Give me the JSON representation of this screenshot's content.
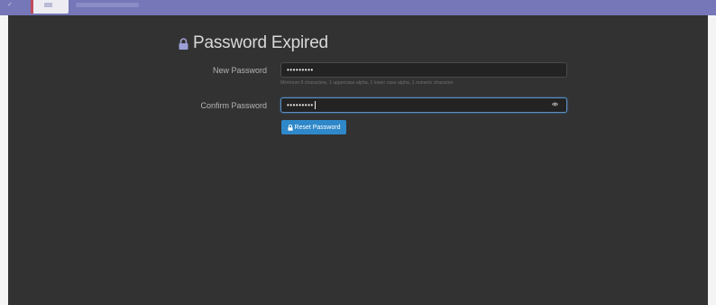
{
  "page": {
    "title": "Password Expired"
  },
  "form": {
    "new_password": {
      "label": "New Password",
      "value": "•••••••••",
      "hint": "Minimum 8 characters, 1 uppercase alpha, 1 lower case alpha, 1 numeric character"
    },
    "confirm_password": {
      "label": "Confirm Password",
      "value": "•••••••••"
    },
    "submit_label": "Reset Password"
  },
  "icons": {
    "title_icon": "lock-icon",
    "button_icon": "lock-icon",
    "reveal_icon": "eye-icon"
  },
  "colors": {
    "topbar": "#7577b9",
    "background": "#323232",
    "accent": "#2f88c9",
    "focus_border": "#5d8fc4"
  }
}
